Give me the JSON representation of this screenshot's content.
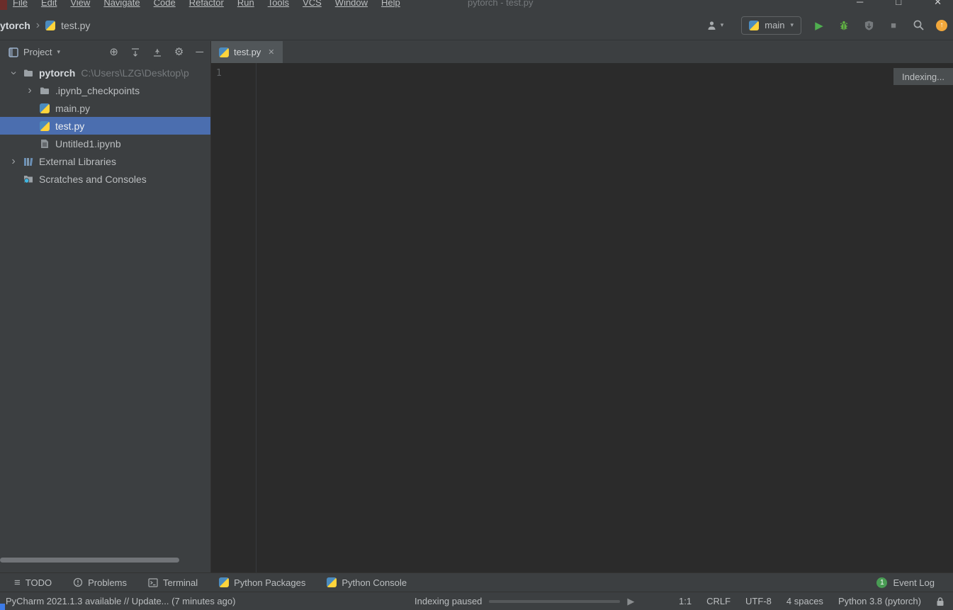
{
  "menubar": {
    "items": [
      "File",
      "Edit",
      "View",
      "Navigate",
      "Code",
      "Refactor",
      "Run",
      "Tools",
      "VCS",
      "Window",
      "Help"
    ],
    "title": "pytorch - test.py"
  },
  "icons": {
    "minimize": "─",
    "maximize": "□",
    "close": "✕",
    "chevron": "›",
    "dropdown_arrow": "▾",
    "locate": "⊕",
    "gear": "⚙",
    "hide": "─",
    "run": "▶",
    "stop": "■",
    "todo_list": "≡",
    "resume": "▶",
    "update_arrow": "↑"
  },
  "navbar": {
    "breadcrumb_project": "ytorch",
    "breadcrumb_file": "test.py",
    "run_config": "main"
  },
  "project_panel": {
    "title": "Project",
    "tree": [
      {
        "label": "pytorch",
        "path": "C:\\Users\\LZG\\Desktop\\p"
      },
      {
        "label": ".ipynb_checkpoints"
      },
      {
        "label": "main.py"
      },
      {
        "label": "test.py"
      },
      {
        "label": "Untitled1.ipynb"
      },
      {
        "label": "External Libraries"
      },
      {
        "label": "Scratches and Consoles"
      }
    ]
  },
  "editor": {
    "tab_label": "test.py",
    "line_number": "1",
    "indexing_label": "Indexing..."
  },
  "tool_windows": {
    "todo": "TODO",
    "problems": "Problems",
    "terminal": "Terminal",
    "python_packages": "Python Packages",
    "python_console": "Python Console",
    "event_log": "Event Log",
    "event_log_badge": "1"
  },
  "statusbar": {
    "message": "PyCharm 2021.1.3 available // Update... (7 minutes ago)",
    "indexing_status": "Indexing paused",
    "caret": "1:1",
    "line_separator": "CRLF",
    "encoding": "UTF-8",
    "indent": "4 spaces",
    "interpreter": "Python 3.8 (pytorch)"
  },
  "colors": {
    "selection_blue": "#4b6eaf",
    "run_green": "#4fae4f",
    "update_orange": "#f1a73b",
    "badge_green": "#499c54"
  }
}
